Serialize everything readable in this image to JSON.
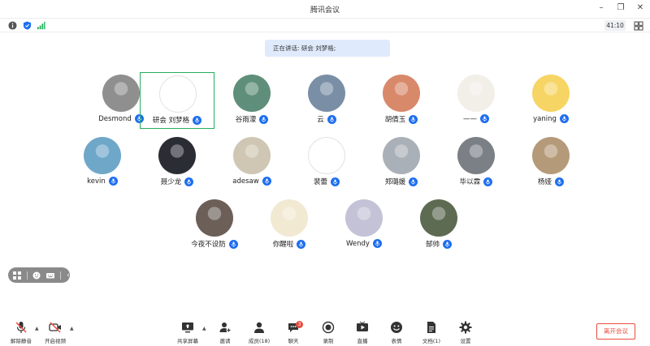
{
  "window": {
    "title": "腾讯会议"
  },
  "infobar": {
    "timer": "41:10"
  },
  "speaking": {
    "text": "正在讲话: 研会 刘梦格;"
  },
  "participants": [
    {
      "name": "Desmond",
      "avatar_color": "#8f8f8f"
    },
    {
      "name": "研会 刘梦格",
      "avatar_color": "#ffffff"
    },
    {
      "name": "谷雨濛",
      "avatar_color": "#5f8f7a"
    },
    {
      "name": "云",
      "avatar_color": "#7a8fa6"
    },
    {
      "name": "胡倩玉",
      "avatar_color": "#d8896a"
    },
    {
      "name": "——",
      "avatar_color": "#f2efe9"
    },
    {
      "name": "yaning",
      "avatar_color": "#f6d564"
    },
    {
      "name": "kevin",
      "avatar_color": "#6fa7c9"
    },
    {
      "name": "聂少龙",
      "avatar_color": "#2b2d35"
    },
    {
      "name": "adesaw",
      "avatar_color": "#cfc6b3"
    },
    {
      "name": "裴蕾",
      "avatar_color": "#ffffff"
    },
    {
      "name": "郑璐媛",
      "avatar_color": "#a9b0b7"
    },
    {
      "name": "毕以霖",
      "avatar_color": "#7b7f86"
    },
    {
      "name": "杨娅",
      "avatar_color": "#b59a7a"
    },
    {
      "name": "今夜不设防",
      "avatar_color": "#6b5f57"
    },
    {
      "name": "你醒啦",
      "avatar_color": "#f1e9d2"
    },
    {
      "name": "Wendy",
      "avatar_color": "#c4c2d6"
    },
    {
      "name": "郜帅",
      "avatar_color": "#5d6b52"
    }
  ],
  "toolbar": {
    "mute": "解除静音",
    "video": "开启视频",
    "share": "共享屏幕",
    "invite": "邀请",
    "members": "成员(18)",
    "chat": "聊天",
    "chat_badge": "3",
    "record": "录制",
    "live": "直播",
    "emoji": "表情",
    "docs": "文档(1)",
    "settings": "设置",
    "leave": "离开会议"
  },
  "colors": {
    "accent": "#1e6ef0",
    "active_speaker": "#22b05b",
    "danger": "#e84c3d"
  }
}
